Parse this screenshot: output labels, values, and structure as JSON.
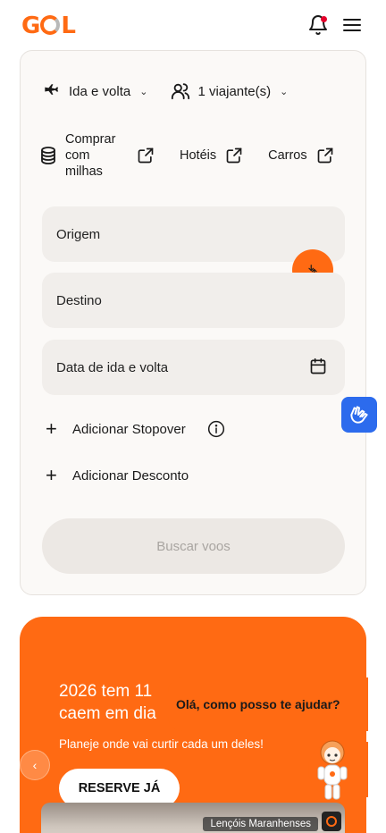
{
  "header": {
    "logo_text_g": "G",
    "logo_text_l": "L",
    "icons": [
      "bell-icon",
      "hamburger-menu-icon"
    ],
    "notification_dot_color": "#e4002b"
  },
  "search": {
    "trip_type": "Ida e volta",
    "travelers": "1 viajante(s)",
    "links": {
      "miles": "Comprar com milhas",
      "hotels": "Hotéis",
      "cars": "Carros"
    },
    "origin_placeholder": "Origem",
    "destination_placeholder": "Destino",
    "dates_placeholder": "Data de ida e volta",
    "add_stopover": "Adicionar Stopover",
    "add_discount": "Adicionar Desconto",
    "submit_label": "Buscar voos"
  },
  "promo": {
    "title": "2026 tem 11 caem em dia",
    "subtitle": "Planeje onde vai curtir cada um deles!",
    "cta": "RESERVE JÁ",
    "image_caption": "Lençóis Maranhenses"
  },
  "chat": {
    "greeting": "Olá, como posso te ajudar?"
  },
  "colors": {
    "brand_orange": "#ff6a13",
    "field_bg": "#f1eeeb",
    "accessibility_blue": "#2c6bed"
  }
}
